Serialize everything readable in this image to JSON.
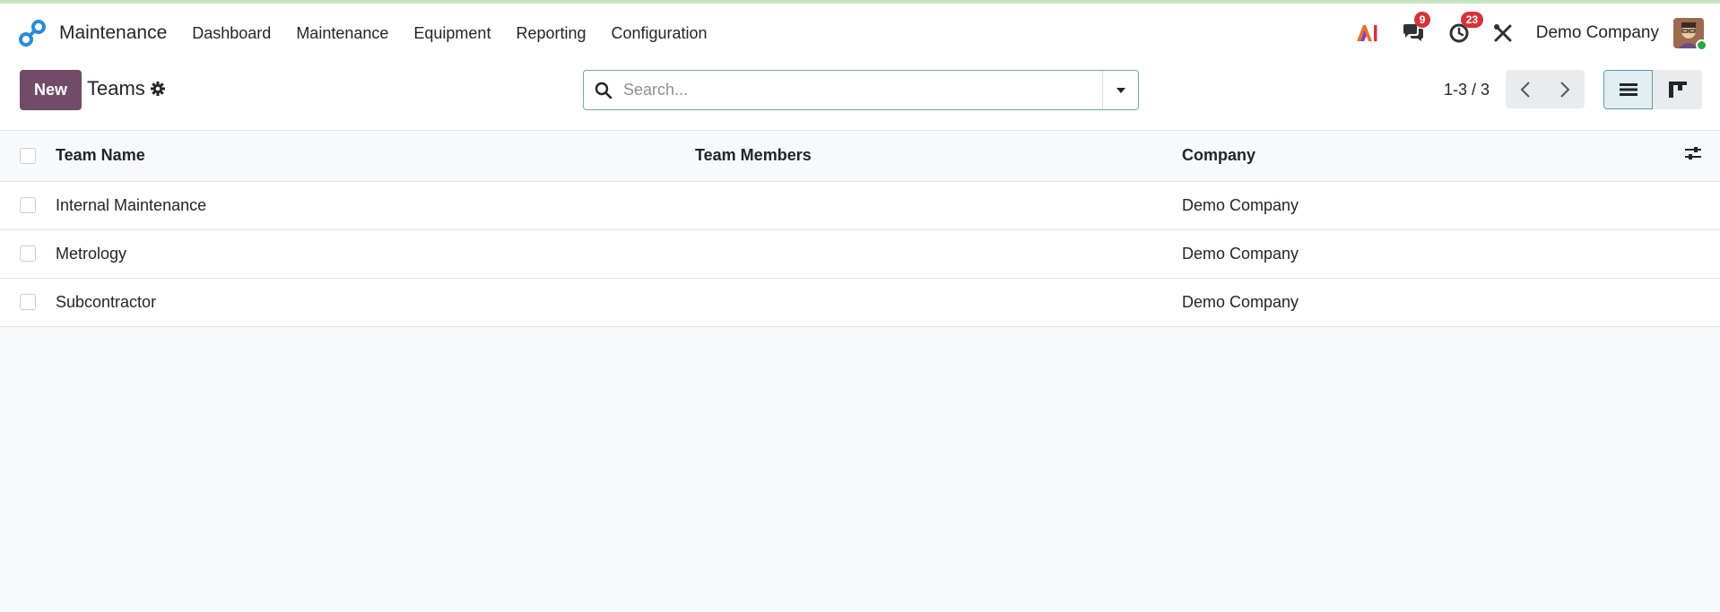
{
  "navbar": {
    "app_name": "Maintenance",
    "menu": [
      "Dashboard",
      "Maintenance",
      "Equipment",
      "Reporting",
      "Configuration"
    ],
    "ai_icon": "ai-icon",
    "messages_count": "9",
    "activities_count": "23",
    "company": "Demo Company"
  },
  "control": {
    "new_label": "New",
    "title": "Teams",
    "search_placeholder": "Search...",
    "pager": "1-3 / 3"
  },
  "table": {
    "columns": [
      "Team Name",
      "Team Members",
      "Company"
    ],
    "rows": [
      {
        "name": "Internal Maintenance",
        "members": "",
        "company": "Demo Company"
      },
      {
        "name": "Metrology",
        "members": "",
        "company": "Demo Company"
      },
      {
        "name": "Subcontractor",
        "members": "",
        "company": "Demo Company"
      }
    ]
  },
  "colors": {
    "primary": "#714b67",
    "badge": "#d6333a",
    "search_border": "#68a9b4"
  }
}
